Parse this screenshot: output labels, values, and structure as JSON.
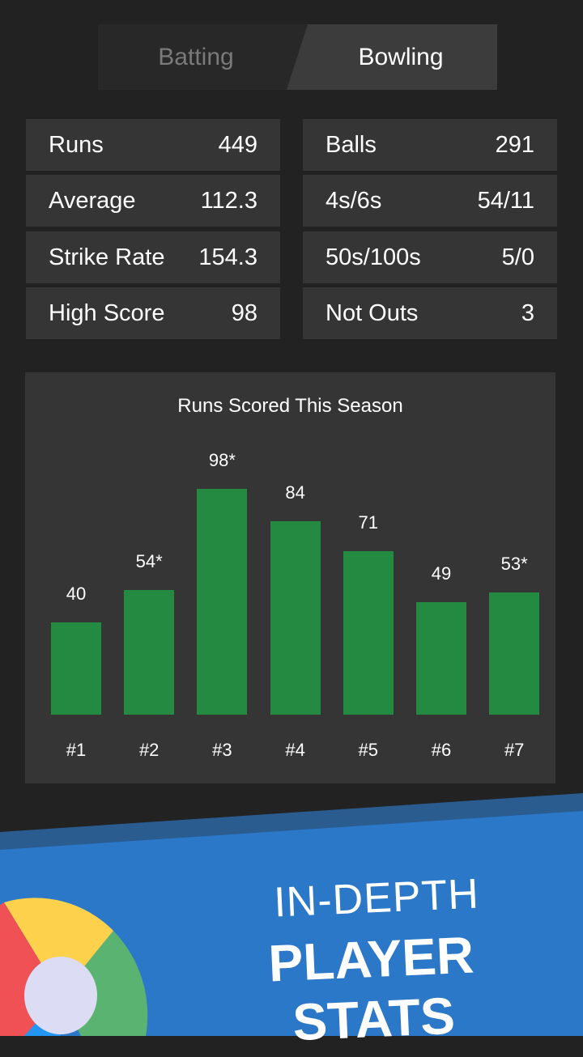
{
  "tabs": [
    {
      "label": "Batting",
      "selected": false
    },
    {
      "label": "Bowling",
      "selected": true
    }
  ],
  "stats_left": [
    {
      "label": "Runs",
      "value": "449"
    },
    {
      "label": "Average",
      "value": "112.3"
    },
    {
      "label": "Strike Rate",
      "value": "154.3"
    },
    {
      "label": "High Score",
      "value": "98"
    }
  ],
  "stats_right": [
    {
      "label": "Balls",
      "value": "291"
    },
    {
      "label": "4s/6s",
      "value": "54/11"
    },
    {
      "label": "50s/100s",
      "value": "5/0"
    },
    {
      "label": "Not Outs",
      "value": "3"
    }
  ],
  "colors": {
    "bar": "#248a41",
    "banner": "#2b78c9",
    "banner_stripe": "#2a5c8f"
  },
  "chart_data": {
    "type": "bar",
    "title": "Runs Scored This Season",
    "categories": [
      "#1",
      "#2",
      "#3",
      "#4",
      "#5",
      "#6",
      "#7"
    ],
    "values": [
      40,
      54,
      98,
      84,
      71,
      49,
      53
    ],
    "value_labels": [
      "40",
      "54*",
      "98*",
      "84",
      "71",
      "49",
      "53*"
    ],
    "xlabel": "",
    "ylabel": "",
    "ylim": [
      0,
      98
    ],
    "grid": false,
    "legend": "none"
  },
  "banner": {
    "line1": "IN-DEPTH",
    "line2": "PLAYER STATS"
  }
}
